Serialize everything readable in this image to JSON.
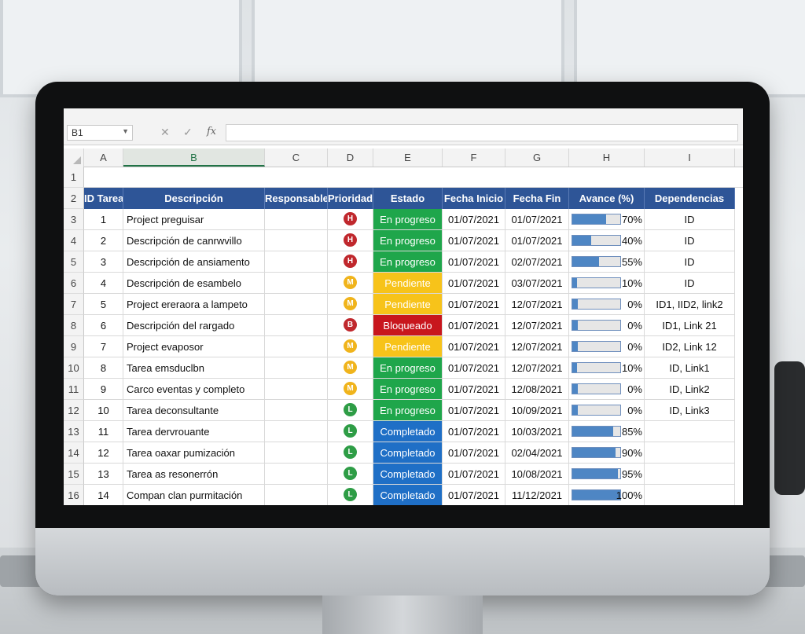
{
  "spreadsheet": {
    "name_box": "B1",
    "formula_icons": [
      "close-icon",
      "check-icon",
      "function-icon"
    ],
    "formula_fx": "fx",
    "column_letters": [
      "A",
      "B",
      "C",
      "D",
      "E",
      "F",
      "G",
      "H",
      "I"
    ],
    "selected_column": "B",
    "row_numbers": [
      "1",
      "2",
      "3",
      "4",
      "5",
      "6",
      "7",
      "8",
      "9",
      "10",
      "11",
      "12",
      "13",
      "14",
      "15",
      "16"
    ],
    "table_headers": [
      "ID Tarea",
      "Descripción",
      "Responsable",
      "Prioridad",
      "Estado",
      "Fecha Inicio",
      "Fecha Fin",
      "Avance (%)",
      "Dependencias"
    ],
    "rows": [
      {
        "id": "1",
        "desc": "Project preguisar",
        "resp": "",
        "prio": "H",
        "estado": "En progreso",
        "inicio": "01/07/2021",
        "fin": "01/07/2021",
        "avance": 70,
        "avance_label": "70%",
        "deps": "ID"
      },
      {
        "id": "2",
        "desc": "Descripción de canrwvillo",
        "resp": "",
        "prio": "H",
        "estado": "En progreso",
        "inicio": "01/07/2021",
        "fin": "01/07/2021",
        "avance": 40,
        "avance_label": "40%",
        "deps": "ID"
      },
      {
        "id": "3",
        "desc": "Descripción de ansiamento",
        "resp": "",
        "prio": "H",
        "estado": "En progreso",
        "inicio": "01/07/2021",
        "fin": "02/07/2021",
        "avance": 55,
        "avance_label": "55%",
        "deps": "ID"
      },
      {
        "id": "4",
        "desc": "Descripción de esambelo",
        "resp": "",
        "prio": "M",
        "estado": "Pendiente",
        "inicio": "01/07/2021",
        "fin": "03/07/2021",
        "avance": 10,
        "avance_label": "10%",
        "deps": "ID"
      },
      {
        "id": "5",
        "desc": "Project ereraora a lampeto",
        "resp": "",
        "prio": "M",
        "estado": "Pendiente",
        "inicio": "01/07/2021",
        "fin": "12/07/2021",
        "avance": 0,
        "avance_label": "0%",
        "deps": "ID1, IID2, link2"
      },
      {
        "id": "6",
        "desc": "Descripción del rargado",
        "resp": "",
        "prio": "B",
        "estado": "Bloqueado",
        "inicio": "01/07/2021",
        "fin": "12/07/2021",
        "avance": 0,
        "avance_label": "0%",
        "deps": "ID1, Link 21"
      },
      {
        "id": "7",
        "desc": "Project evaposor",
        "resp": "",
        "prio": "M",
        "estado": "Pendiente",
        "inicio": "01/07/2021",
        "fin": "12/07/2021",
        "avance": 0,
        "avance_label": "0%",
        "deps": "ID2, Link 12"
      },
      {
        "id": "8",
        "desc": "Tarea emsduclbn",
        "resp": "",
        "prio": "M",
        "estado": "En progreso",
        "inicio": "01/07/2021",
        "fin": "12/07/2021",
        "avance": 10,
        "avance_label": "10%",
        "deps": "ID, Link1"
      },
      {
        "id": "9",
        "desc": "Carco eventas y completo",
        "resp": "",
        "prio": "M",
        "estado": "En progreso",
        "inicio": "01/07/2021",
        "fin": "12/08/2021",
        "avance": 0,
        "avance_label": "0%",
        "deps": "ID, Link2"
      },
      {
        "id": "10",
        "desc": "Tarea deconsultante",
        "resp": "",
        "prio": "L",
        "estado": "En progreso",
        "inicio": "01/07/2021",
        "fin": "10/09/2021",
        "avance": 0,
        "avance_label": "0%",
        "deps": "ID, Link3"
      },
      {
        "id": "11",
        "desc": "Tarea dervrouante",
        "resp": "",
        "prio": "L",
        "estado": "Completado",
        "inicio": "01/07/2021",
        "fin": "10/03/2021",
        "avance": 85,
        "avance_label": "85%",
        "deps": ""
      },
      {
        "id": "12",
        "desc": "Tarea oaxar pumización",
        "resp": "",
        "prio": "L",
        "estado": "Completado",
        "inicio": "01/07/2021",
        "fin": "02/04/2021",
        "avance": 90,
        "avance_label": "90%",
        "deps": ""
      },
      {
        "id": "13",
        "desc": "Tarea as resonerrón",
        "resp": "",
        "prio": "L",
        "estado": "Completado",
        "inicio": "01/07/2021",
        "fin": "10/08/2021",
        "avance": 95,
        "avance_label": "95%",
        "deps": ""
      },
      {
        "id": "14",
        "desc": "Compan clan purmitación",
        "resp": "",
        "prio": "L",
        "estado": "Completado",
        "inicio": "01/07/2021",
        "fin": "11/12/2021",
        "avance": 100,
        "avance_label": "100%",
        "deps": ""
      }
    ],
    "priority_colors": {
      "H": "#c0282d",
      "M": "#f0b41c",
      "B": "#c0282d",
      "L": "#2e9d46"
    },
    "estado_colors": {
      "En progreso": "#1fa64b",
      "Pendiente": "#f7c31a",
      "Bloqueado": "#c8161d",
      "Completado": "#1f6fc6"
    },
    "header_color": "#2e5597"
  }
}
